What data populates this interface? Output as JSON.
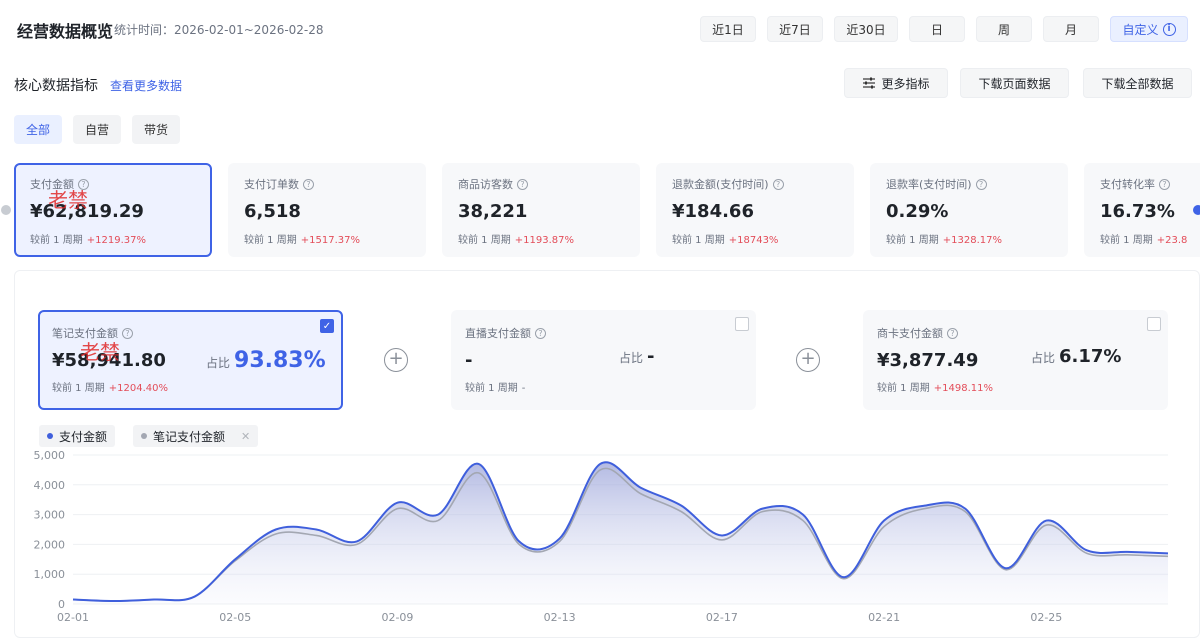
{
  "header": {
    "title": "经营数据概览",
    "period": "统计时间：2026-02-01~2026-02-28",
    "ranges": [
      "近1日",
      "近7日",
      "近30日",
      "日",
      "周",
      "月"
    ],
    "custom_label": "自定义",
    "custom_icon": "info-icon"
  },
  "section": {
    "title": "核心数据指标",
    "more_link": "查看更多数据",
    "more_metrics": "更多指标",
    "more_metrics_icon": "sliders-icon",
    "download_page": "下载页面数据",
    "download_all": "下载全部数据"
  },
  "tabs": [
    "全部",
    "自营",
    "带货"
  ],
  "metrics": [
    {
      "label": "支付金额",
      "value": "¥62,819.29",
      "cmp": "较前 1 周期",
      "pct": "+1219.37%"
    },
    {
      "label": "支付订单数",
      "value": "6,518",
      "cmp": "较前 1 周期",
      "pct": "+1517.37%"
    },
    {
      "label": "商品访客数",
      "value": "38,221",
      "cmp": "较前 1 周期",
      "pct": "+1193.87%"
    },
    {
      "label": "退款金额(支付时间)",
      "value": "¥184.66",
      "cmp": "较前 1 周期",
      "pct": "+18743%"
    },
    {
      "label": "退款率(支付时间)",
      "value": "0.29%",
      "cmp": "较前 1 周期",
      "pct": "+1328.17%"
    },
    {
      "label": "支付转化率",
      "value": "16.73%",
      "cmp": "较前 1 周期",
      "pct": "+23.8"
    }
  ],
  "watermark": "老禁",
  "breakdown": {
    "share_label": "占比",
    "items": [
      {
        "label": "笔记支付金额",
        "value": "¥58,941.80",
        "share": "93.83%",
        "cmp": "较前 1 周期",
        "pct": "+1204.40%",
        "checked": true
      },
      {
        "label": "直播支付金额",
        "value": "-",
        "share": "-",
        "cmp": "较前 1 周期",
        "pct": "-",
        "checked": false
      },
      {
        "label": "商卡支付金额",
        "value": "¥3,877.49",
        "share": "6.17%",
        "cmp": "较前 1 周期",
        "pct": "+1498.11%",
        "checked": false
      }
    ],
    "plus_icon": "plus-circle-icon"
  },
  "legend": {
    "items": [
      "支付金额",
      "笔记支付金额"
    ],
    "close_icon": "close-icon"
  },
  "colors": {
    "accent": "#3f63e6",
    "negative_red": "#e34d59",
    "series_primary": "#3f5fdc",
    "series_secondary": "#a3a7b2"
  },
  "chart_data": {
    "type": "area",
    "x": [
      "02-01",
      "02-02",
      "02-03",
      "02-04",
      "02-05",
      "02-06",
      "02-07",
      "02-08",
      "02-09",
      "02-10",
      "02-11",
      "02-12",
      "02-13",
      "02-14",
      "02-15",
      "02-16",
      "02-17",
      "02-18",
      "02-19",
      "02-20",
      "02-21",
      "02-22",
      "02-23",
      "02-24",
      "02-25",
      "02-26",
      "02-27",
      "02-28"
    ],
    "x_ticks": [
      "02-01",
      "02-05",
      "02-09",
      "02-13",
      "02-17",
      "02-21",
      "02-25"
    ],
    "y_ticks": [
      "0",
      "1,000",
      "2,000",
      "3,000",
      "4,000",
      "5,000"
    ],
    "ylim": [
      0,
      5000
    ],
    "grid": true,
    "series": [
      {
        "name": "支付金额",
        "values": [
          150,
          100,
          150,
          250,
          1500,
          2500,
          2500,
          2100,
          3400,
          3000,
          4700,
          2100,
          2200,
          4700,
          3900,
          3300,
          2300,
          3200,
          3000,
          900,
          2800,
          3300,
          3200,
          1200,
          2800,
          1800,
          1750,
          1700
        ]
      },
      {
        "name": "笔记支付金额",
        "values": [
          150,
          100,
          150,
          250,
          1450,
          2350,
          2300,
          2000,
          3200,
          2800,
          4400,
          2000,
          2100,
          4500,
          3700,
          3100,
          2150,
          3100,
          2800,
          850,
          2600,
          3200,
          3100,
          1150,
          2650,
          1700,
          1650,
          1600
        ]
      }
    ]
  }
}
